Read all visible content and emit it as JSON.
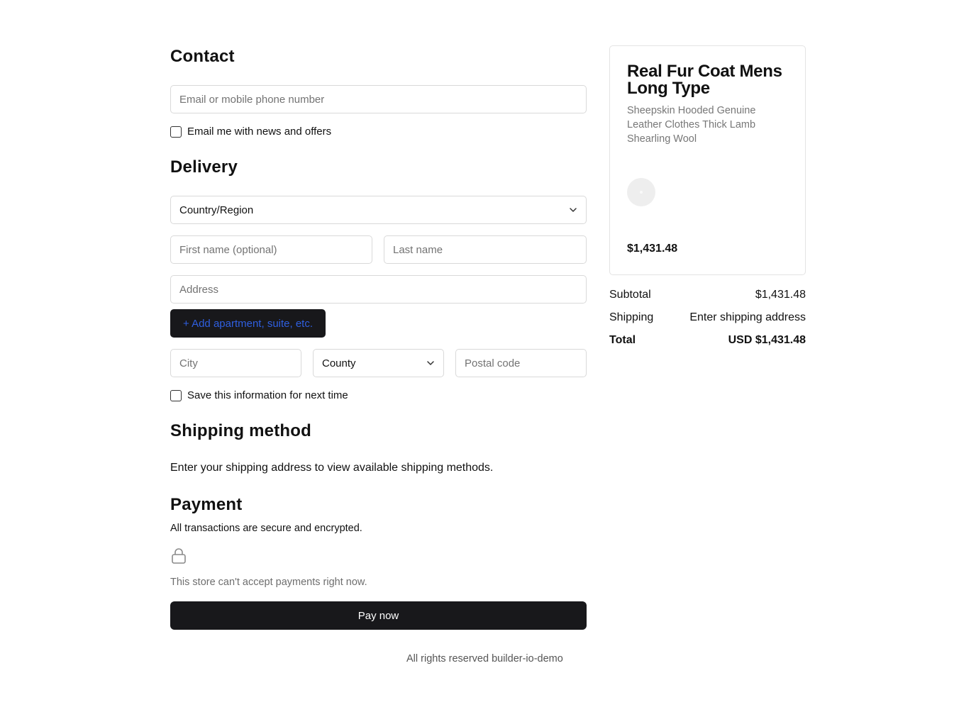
{
  "contact": {
    "title": "Contact",
    "email_placeholder": "Email or mobile phone number",
    "newsletter_label": "Email me with news and offers"
  },
  "delivery": {
    "title": "Delivery",
    "country_value": "Country/Region",
    "first_name_placeholder": "First name (optional)",
    "last_name_placeholder": "Last name",
    "address_placeholder": "Address",
    "add_apartment_label": "+ Add apartment, suite, etc.",
    "city_placeholder": "City",
    "county_value": "County",
    "postal_placeholder": "Postal code",
    "save_info_label": "Save this information for next time"
  },
  "shipping_method": {
    "title": "Shipping method",
    "message": "Enter your shipping address to view available shipping methods."
  },
  "payment": {
    "title": "Payment",
    "secure_note": "All transactions are secure and encrypted.",
    "icon": "lock-icon",
    "unavailable_note": "This store can't accept payments right now.",
    "pay_button_label": "Pay now"
  },
  "footer": {
    "text": "All rights reserved builder-io-demo"
  },
  "order_summary": {
    "product": {
      "title": "Real Fur Coat Mens Long Type",
      "description": "Sheepskin Hooded Genuine Leather Clothes Thick Lamb Shearling Wool",
      "price": "$1,431.48"
    },
    "subtotal_label": "Subtotal",
    "subtotal_value": "$1,431.48",
    "shipping_label": "Shipping",
    "shipping_value": "Enter shipping address",
    "total_label": "Total",
    "total_value": "USD $1,431.48"
  },
  "colors": {
    "primary_button_bg": "#18181b",
    "link_blue": "#2f5fe0",
    "border": "#d9d9d9",
    "muted_text": "#737373"
  }
}
